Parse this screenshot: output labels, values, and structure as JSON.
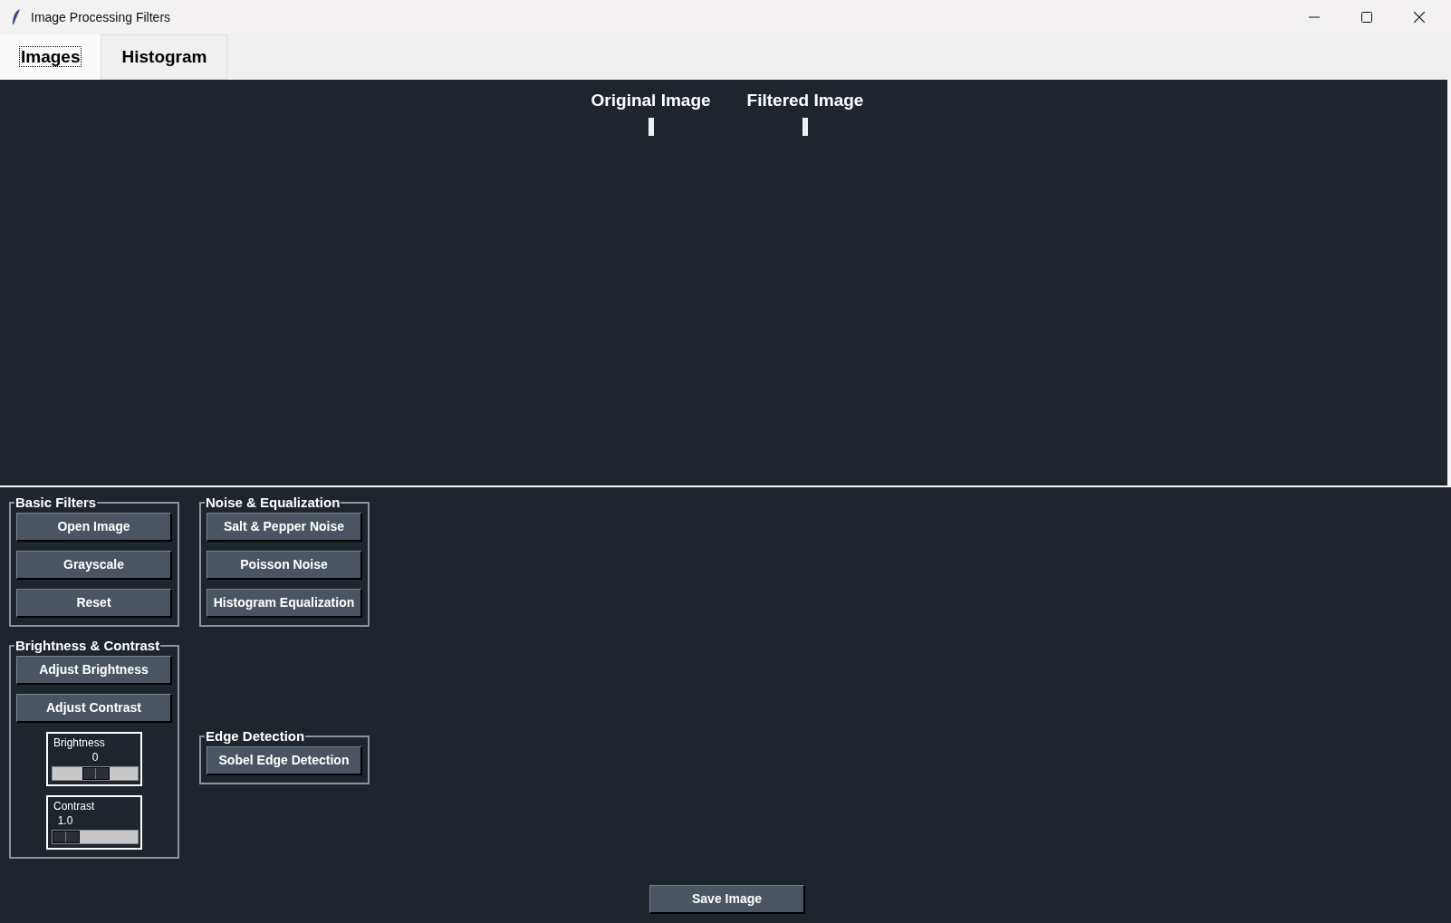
{
  "window": {
    "title": "Image Processing Filters"
  },
  "tabs": [
    {
      "label": "Images",
      "selected": true
    },
    {
      "label": "Histogram",
      "selected": false
    }
  ],
  "image_panels": [
    {
      "title": "Original Image"
    },
    {
      "title": "Filtered Image"
    }
  ],
  "columns": [
    {
      "groups": [
        {
          "title": "Basic Filters",
          "items": [
            {
              "kind": "button",
              "label": "Open Image"
            },
            {
              "kind": "button",
              "label": "Grayscale"
            },
            {
              "kind": "button",
              "label": "Reset"
            }
          ]
        },
        {
          "title": "Brightness & Contrast",
          "items": [
            {
              "kind": "button",
              "label": "Adjust Brightness"
            },
            {
              "kind": "button",
              "label": "Adjust Contrast"
            },
            {
              "kind": "slider",
              "label": "Brightness",
              "reading": "0",
              "level": 0.5
            },
            {
              "kind": "slider",
              "label": "Contrast",
              "reading": "1.0",
              "level": 0
            }
          ]
        }
      ]
    },
    {
      "groups": [
        {
          "title": "Noise & Equalization",
          "items": [
            {
              "kind": "button",
              "label": "Salt & Pepper Noise"
            },
            {
              "kind": "button",
              "label": "Poisson Noise"
            },
            {
              "kind": "button",
              "label": "Histogram Equalization"
            }
          ]
        },
        {
          "title": "Edge Detection",
          "items": [
            {
              "kind": "button",
              "label": "Sobel Edge Detection"
            }
          ]
        }
      ]
    }
  ],
  "save_button": {
    "label": "Save Image"
  }
}
